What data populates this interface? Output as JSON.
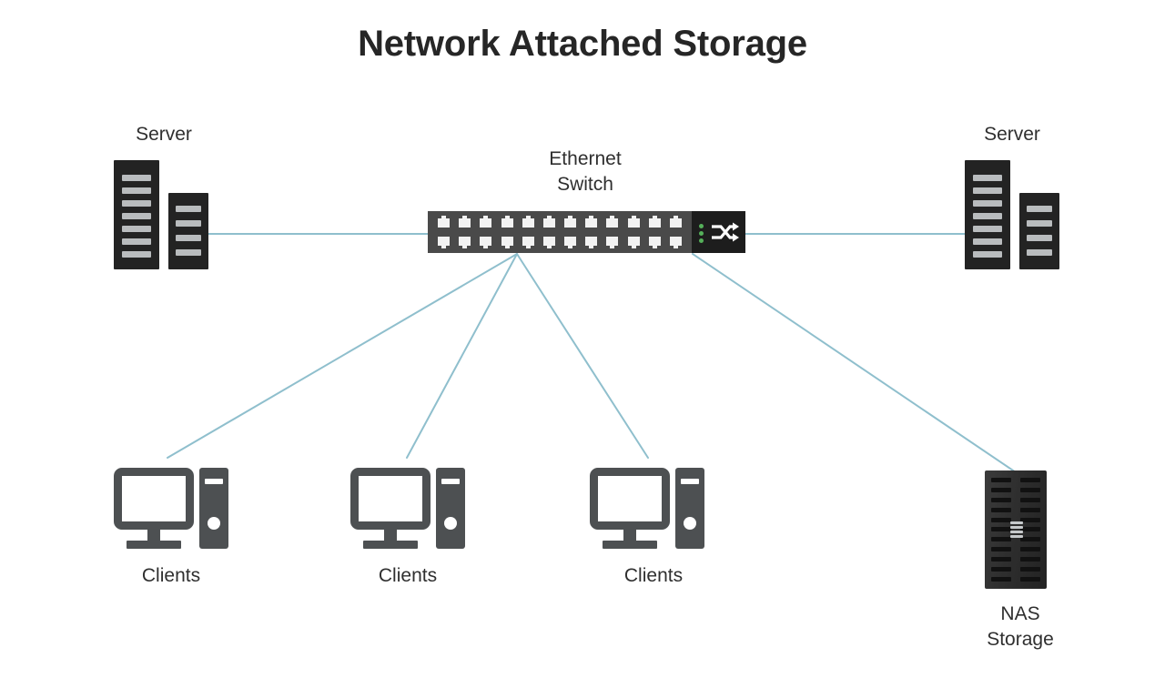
{
  "title": "Network Attached Storage",
  "colors": {
    "background": "#ffffff",
    "title_text": "#262626",
    "label_text": "#2f2f2f",
    "link_line": "#8fbfcd",
    "server_chassis": "#232323",
    "server_bar": "#b9bcbe",
    "switch_body": "#4a4a4a",
    "switch_panel": "#1d1d1d",
    "switch_port": "#f2f2f2",
    "switch_led": "#55b05a",
    "client_gray": "#4d5052",
    "client_screen": "#ffffff",
    "nas_body": "#2e2e2e",
    "nas_slot": "#111111",
    "nas_accent": "#c6c9cb"
  },
  "nodes": {
    "server_left": {
      "label": "Server",
      "icon": "server-rack-icon",
      "tall_rack_bars": 7,
      "short_rack_bars": 4
    },
    "server_right": {
      "label": "Server",
      "icon": "server-rack-icon",
      "tall_rack_bars": 7,
      "short_rack_bars": 4
    },
    "ethernet_switch": {
      "label": "Ethernet\nSwitch",
      "icon": "network-switch-icon",
      "port_columns": 12,
      "port_rows": 2,
      "led_count": 3,
      "panel_icon": "shuffle-arrows-icon"
    },
    "client_1": {
      "label": "Clients",
      "icon": "desktop-computer-icon"
    },
    "client_2": {
      "label": "Clients",
      "icon": "desktop-computer-icon"
    },
    "client_3": {
      "label": "Clients",
      "icon": "desktop-computer-icon"
    },
    "nas": {
      "label": "NAS\nStorage",
      "icon": "nas-storage-icon",
      "slot_rows": 11,
      "slot_columns": 2,
      "accent_lines": 4
    }
  },
  "links": [
    {
      "name": "link-server-left-to-switch",
      "from": "server_left",
      "to": "ethernet_switch"
    },
    {
      "name": "link-switch-to-server-right",
      "from": "ethernet_switch",
      "to": "server_right"
    },
    {
      "name": "link-switch-to-client-1",
      "from": "ethernet_switch",
      "to": "client_1"
    },
    {
      "name": "link-switch-to-client-2",
      "from": "ethernet_switch",
      "to": "client_2"
    },
    {
      "name": "link-switch-to-client-3",
      "from": "ethernet_switch",
      "to": "client_3"
    },
    {
      "name": "link-switch-to-nas",
      "from": "ethernet_switch",
      "to": "nas"
    }
  ]
}
